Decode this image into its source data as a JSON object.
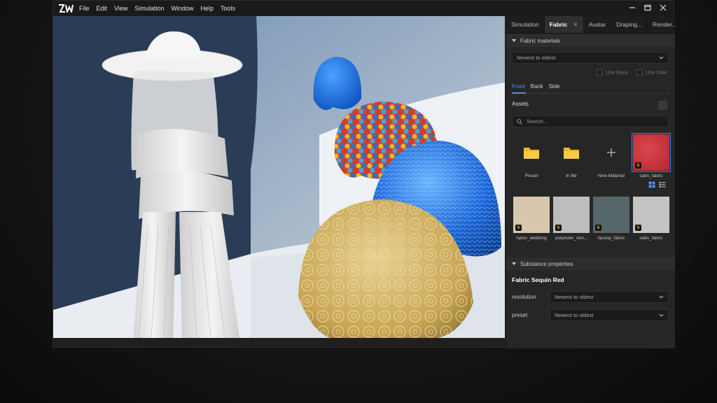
{
  "menu": {
    "logo_text": "ZW",
    "items": [
      "File",
      "Edit",
      "View",
      "Simulation",
      "Window",
      "Help",
      "Tools"
    ]
  },
  "panel": {
    "tabs": [
      {
        "label": "Simulation",
        "active": false
      },
      {
        "label": "Fabric",
        "active": true
      },
      {
        "label": "Avatar",
        "active": false
      },
      {
        "label": "Draping...",
        "active": false
      },
      {
        "label": "Render...",
        "active": false
      }
    ],
    "fabric_materials": {
      "header": "Fabric materials",
      "sort_value": "Newest to oldest",
      "use_back": "Use Back",
      "use_side": "Use Side",
      "subtabs": [
        "Front",
        "Back",
        "Side"
      ],
      "assets_label": "Assets",
      "search_placeholder": "Search...",
      "grid_row1": [
        {
          "label": "Preset",
          "kind": "folder"
        },
        {
          "label": "In file",
          "kind": "folder"
        },
        {
          "label": "New Material",
          "kind": "add"
        },
        {
          "label": "satin_fabric",
          "kind": "swatch",
          "color": "#c8323c",
          "selected": true
        }
      ],
      "grid_row2": [
        {
          "label": "nylon_webbing",
          "color": "#d9c6ae"
        },
        {
          "label": "polyester_stre...",
          "color": "#bdbdbd"
        },
        {
          "label": "ripstop_fabric",
          "color": "#56676a"
        },
        {
          "label": "satin_fabric",
          "color": "#c4c4c4"
        }
      ]
    },
    "substance": {
      "header": "Substance properties",
      "title": "Fabric Sequin Red",
      "resolution_label": "resolution",
      "resolution_value": "Newest to oldest",
      "preset_label": "preset",
      "preset_value": "Newest to oldest"
    }
  },
  "colors": {
    "accent": "#4a90e2",
    "badge": "#f2c200",
    "folder": "#f0b429"
  }
}
